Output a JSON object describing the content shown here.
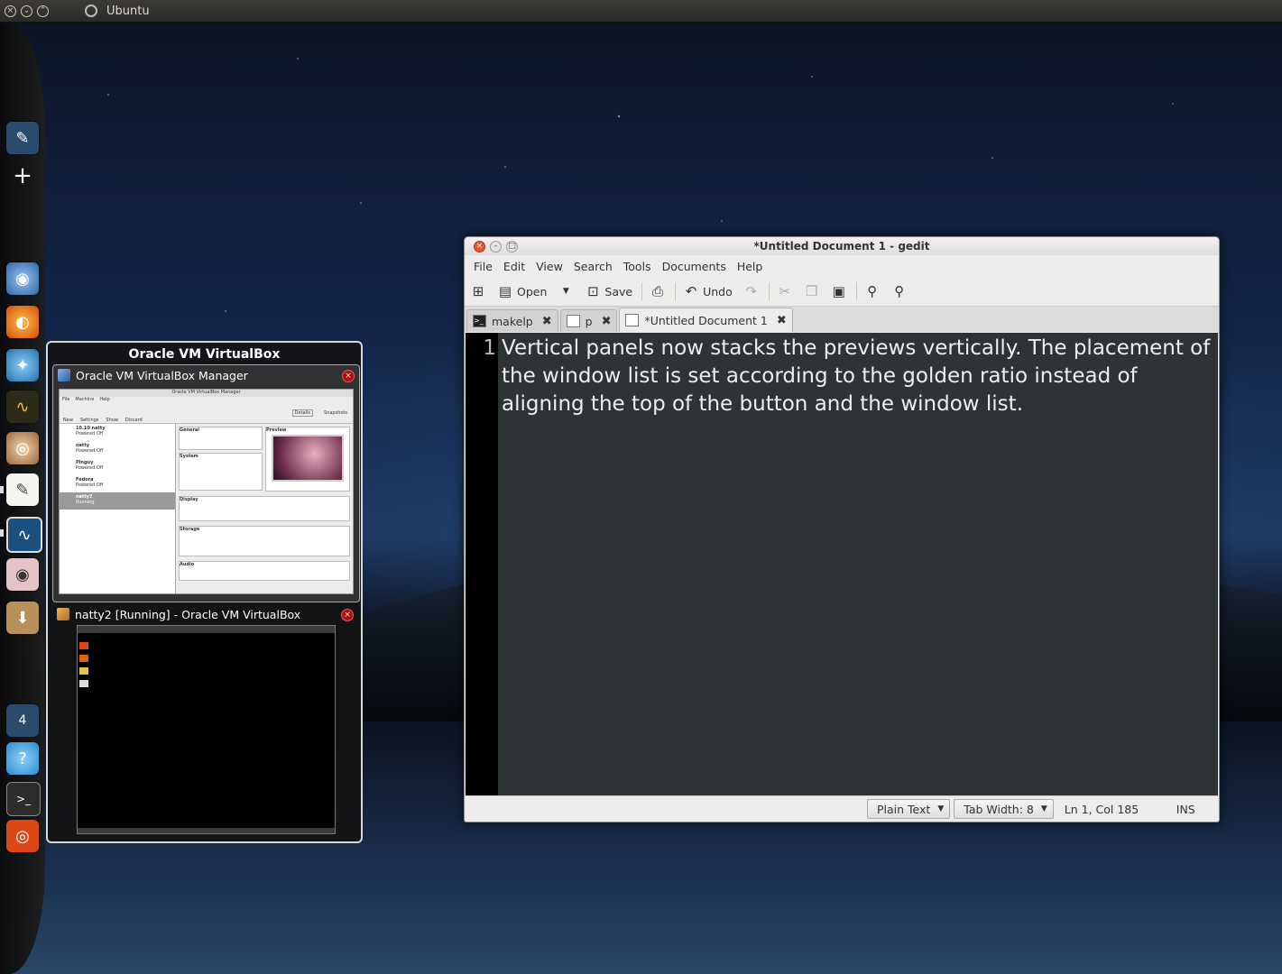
{
  "top_panel": {
    "title": "Ubuntu"
  },
  "launcher": {
    "items": [
      {
        "name": "workspace-switcher",
        "color": "#2a4a6e"
      },
      {
        "name": "add",
        "color": "#1a1a1a"
      },
      {
        "name": "chromium",
        "color": "#3a6fb3"
      },
      {
        "name": "firefox",
        "color": "#e66000"
      },
      {
        "name": "birdie",
        "color": "#2b8ccf"
      },
      {
        "name": "system-monitor",
        "color": "#3a3a1a"
      },
      {
        "name": "nautilus-shell",
        "color": "#b38252"
      },
      {
        "name": "gedit",
        "color": "#e8e8e8"
      },
      {
        "name": "virtualbox-monitor",
        "color": "#1b4f80"
      },
      {
        "name": "eye-of-gnome",
        "color": "#d8a7b0"
      },
      {
        "name": "package-installer",
        "color": "#b89058"
      },
      {
        "name": "workspaces",
        "color": "#2a4a6e",
        "label": "4"
      },
      {
        "name": "empathy",
        "color": "#2b8ccf"
      },
      {
        "name": "terminal",
        "color": "#2c2c2c"
      },
      {
        "name": "ubuntu-one",
        "color": "#dd4814"
      }
    ]
  },
  "window_list": {
    "app_title": "Oracle VM VirtualBox",
    "entries": [
      {
        "title": "Oracle VM VirtualBox Manager",
        "close": "×"
      },
      {
        "title": "natty2 [Running] - Oracle VM VirtualBox",
        "close": "×"
      }
    ],
    "thumb1": {
      "window_title": "Oracle VM VirtualBox Manager",
      "menu": [
        "File",
        "Machine",
        "Help"
      ],
      "toolbar": [
        "New",
        "Settings",
        "Show",
        "Discard"
      ],
      "details_btn": "Details",
      "snapshots_btn": "Snapshots",
      "vms": [
        {
          "name": "10.10 natty",
          "state": "Powered Off"
        },
        {
          "name": "natty",
          "state": "Powered Off"
        },
        {
          "name": "Pinguy",
          "state": "Powered Off"
        },
        {
          "name": "Fedora",
          "state": "Powered Off"
        },
        {
          "name": "natty2",
          "state": "Running"
        }
      ],
      "sections": [
        "General",
        "System",
        "Preview",
        "Display",
        "Storage",
        "Audio"
      ]
    }
  },
  "gedit": {
    "title": "*Untitled Document 1 - gedit",
    "menu": [
      "File",
      "Edit",
      "View",
      "Search",
      "Tools",
      "Documents",
      "Help"
    ],
    "toolbar": {
      "open": "Open",
      "save": "Save",
      "undo": "Undo"
    },
    "tabs": [
      {
        "label": "makelp",
        "close": "✖"
      },
      {
        "label": "p",
        "close": "✖"
      },
      {
        "label": "*Untitled Document 1",
        "close": "✖"
      }
    ],
    "line_number": "1",
    "content": "Vertical panels now stacks the previews vertically. The placement of the window list is set according to the golden ratio instead of aligning the top of the button and the window list.",
    "status": {
      "language": "Plain Text",
      "tab_width": "Tab Width:  8",
      "position": "Ln 1, Col 185",
      "mode": "INS"
    },
    "colors": {
      "editor_bg": "#2e3436",
      "editor_fg": "#eeeeec",
      "close_btn": "#e05a2d"
    }
  }
}
